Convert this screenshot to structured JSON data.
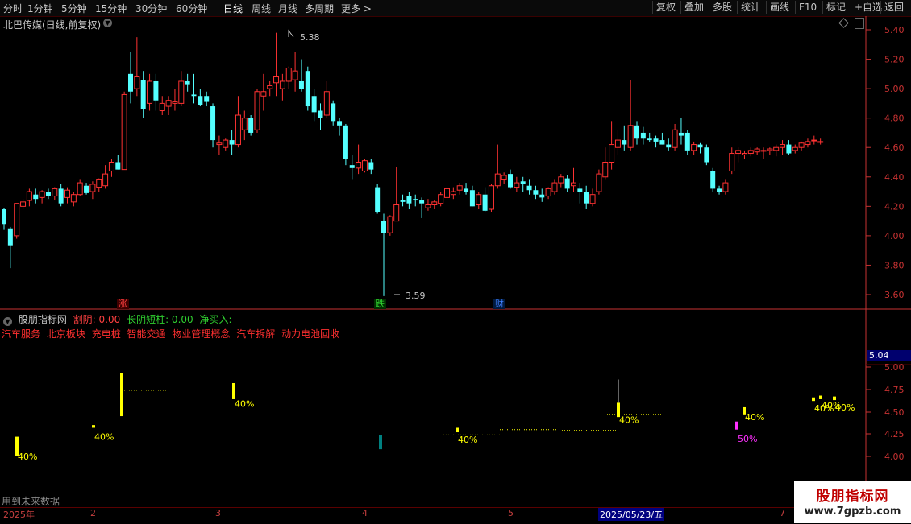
{
  "toolbar": {
    "timeframes": [
      "分时",
      "1分钟",
      "5分钟",
      "15分钟",
      "30分钟",
      "60分钟",
      "日线",
      "周线",
      "月线",
      "多周期",
      "更多 >"
    ],
    "active": "日线",
    "buttons": [
      "复权",
      "叠加",
      "多股",
      "统计",
      "画线",
      "F10",
      "标记",
      "+自选",
      "返回"
    ]
  },
  "chart_title": "北巴传媒(日线,前复权)",
  "annotations": {
    "high_label": "5.38",
    "low_label": "3.59"
  },
  "event_tags": [
    {
      "label": "涨",
      "color": "#ff4040"
    },
    {
      "label": "跌",
      "color": "#30d030"
    },
    {
      "label": "财",
      "color": "#4080ff"
    }
  ],
  "indicator": {
    "name": "股朋指标网",
    "fields": [
      {
        "label": "割阴: 0.00",
        "color": "#ff4040"
      },
      {
        "label": "长阴短柱: 0.00",
        "color": "#30d030"
      },
      {
        "label": "净买入: -",
        "color": "#30d030"
      }
    ],
    "sectors": [
      "汽车服务",
      "北京板块",
      "充电桩",
      "智能交通",
      "物业管理概念",
      "汽车拆解",
      "动力电池回收"
    ],
    "current_price": "5.04",
    "percent_labels": [
      "40%",
      "40%",
      "40%",
      "40%",
      "40%",
      "50%",
      "40%",
      "40%",
      "40%",
      "40%"
    ]
  },
  "future_data": "用到未来数据",
  "watermark": {
    "title": "股朋指标网",
    "url": "www.7gpzb.com"
  },
  "dates": [
    "2025年",
    "2",
    "3",
    "4",
    "5",
    "2025/05/23/五",
    "7"
  ],
  "colors": {
    "up": "#ff3232",
    "down": "#54ffff",
    "yellow": "#ffff00",
    "magenta": "#ff30ff",
    "teal": "#008080",
    "axis": "#c83232"
  },
  "chart_data": {
    "type": "candlestick",
    "y_ticks": [
      "5.40",
      "5.20",
      "5.00",
      "4.80",
      "4.60",
      "4.40",
      "4.20",
      "4.00",
      "3.80",
      "3.60"
    ],
    "ylim": [
      3.56,
      5.45
    ],
    "ohlc": [
      [
        4.18,
        4.19,
        4.04,
        4.08
      ],
      [
        4.05,
        4.06,
        3.78,
        3.93
      ],
      [
        4.0,
        4.22,
        3.98,
        4.22
      ],
      [
        4.2,
        4.25,
        4.18,
        4.23
      ],
      [
        4.24,
        4.32,
        4.2,
        4.3
      ],
      [
        4.28,
        4.32,
        4.22,
        4.25
      ],
      [
        4.26,
        4.31,
        4.22,
        4.3
      ],
      [
        4.3,
        4.32,
        4.25,
        4.27
      ],
      [
        4.27,
        4.33,
        4.24,
        4.32
      ],
      [
        4.32,
        4.35,
        4.2,
        4.22
      ],
      [
        4.26,
        4.33,
        4.22,
        4.31
      ],
      [
        4.23,
        4.3,
        4.2,
        4.28
      ],
      [
        4.28,
        4.38,
        4.27,
        4.36
      ],
      [
        4.34,
        4.36,
        4.28,
        4.29
      ],
      [
        4.3,
        4.37,
        4.25,
        4.35
      ],
      [
        4.33,
        4.39,
        4.3,
        4.38
      ],
      [
        4.34,
        4.48,
        4.32,
        4.42
      ],
      [
        4.44,
        4.52,
        4.4,
        4.5
      ],
      [
        4.5,
        4.55,
        4.45,
        4.45
      ],
      [
        4.45,
        4.98,
        4.46,
        4.96
      ],
      [
        5.1,
        5.25,
        4.9,
        4.98
      ],
      [
        5.0,
        5.35,
        4.95,
        5.08
      ],
      [
        5.06,
        5.12,
        4.8,
        4.86
      ],
      [
        4.9,
        5.1,
        4.85,
        5.05
      ],
      [
        5.05,
        5.1,
        4.85,
        4.92
      ],
      [
        4.85,
        4.95,
        4.82,
        4.9
      ],
      [
        4.88,
        4.95,
        4.82,
        4.92
      ],
      [
        4.9,
        5.0,
        4.85,
        4.91
      ],
      [
        4.9,
        5.12,
        4.88,
        5.05
      ],
      [
        5.05,
        5.1,
        4.98,
        5.03
      ],
      [
        4.96,
        5.1,
        4.9,
        4.95
      ],
      [
        4.95,
        5.0,
        4.88,
        4.89
      ],
      [
        4.95,
        4.98,
        4.88,
        4.91
      ],
      [
        4.88,
        4.9,
        4.6,
        4.65
      ],
      [
        4.62,
        4.68,
        4.55,
        4.63
      ],
      [
        4.6,
        4.66,
        4.58,
        4.65
      ],
      [
        4.65,
        4.72,
        4.55,
        4.62
      ],
      [
        4.62,
        4.95,
        4.6,
        4.82
      ],
      [
        4.72,
        4.85,
        4.65,
        4.8
      ],
      [
        4.8,
        4.82,
        4.68,
        4.7
      ],
      [
        4.72,
        5.0,
        4.7,
        4.98
      ],
      [
        4.95,
        5.1,
        4.85,
        4.98
      ],
      [
        5.0,
        5.05,
        4.95,
        5.02
      ],
      [
        5.04,
        5.38,
        4.95,
        5.08
      ],
      [
        5.0,
        5.1,
        4.92,
        5.05
      ],
      [
        5.05,
        5.15,
        5.0,
        5.14
      ],
      [
        5.06,
        5.25,
        4.98,
        5.12
      ],
      [
        5.05,
        5.2,
        4.98,
        5.0
      ],
      [
        5.12,
        5.15,
        4.85,
        4.88
      ],
      [
        4.95,
        5.0,
        4.78,
        4.84
      ],
      [
        4.85,
        4.9,
        4.72,
        4.8
      ],
      [
        4.82,
        5.05,
        4.8,
        4.98
      ],
      [
        4.9,
        4.92,
        4.75,
        4.78
      ],
      [
        4.78,
        4.8,
        4.68,
        4.75
      ],
      [
        4.75,
        4.76,
        4.48,
        4.52
      ],
      [
        4.48,
        4.55,
        4.38,
        4.46
      ],
      [
        4.46,
        4.62,
        4.42,
        4.5
      ],
      [
        4.44,
        4.52,
        4.43,
        4.51
      ],
      [
        4.5,
        4.52,
        4.42,
        4.45
      ],
      [
        4.33,
        4.35,
        4.15,
        4.16
      ],
      [
        4.1,
        4.15,
        3.59,
        4.02
      ],
      [
        4.02,
        4.14,
        4.0,
        4.13
      ],
      [
        4.1,
        4.47,
        4.1,
        4.21
      ],
      [
        4.24,
        4.28,
        4.2,
        4.23
      ],
      [
        4.27,
        4.3,
        4.18,
        4.22
      ],
      [
        4.25,
        4.28,
        4.2,
        4.24
      ],
      [
        4.24,
        4.26,
        4.12,
        4.22
      ],
      [
        4.19,
        4.25,
        4.17,
        4.21
      ],
      [
        4.21,
        4.24,
        4.18,
        4.23
      ],
      [
        4.22,
        4.3,
        4.2,
        4.28
      ],
      [
        4.26,
        4.34,
        4.24,
        4.32
      ],
      [
        4.28,
        4.33,
        4.25,
        4.3
      ],
      [
        4.31,
        4.36,
        4.28,
        4.34
      ],
      [
        4.32,
        4.36,
        4.28,
        4.3
      ],
      [
        4.31,
        4.34,
        4.2,
        4.2
      ],
      [
        4.21,
        4.3,
        4.18,
        4.28
      ],
      [
        4.28,
        4.33,
        4.16,
        4.17
      ],
      [
        4.18,
        4.35,
        4.16,
        4.34
      ],
      [
        4.34,
        4.62,
        4.32,
        4.42
      ],
      [
        4.38,
        4.43,
        4.35,
        4.41
      ],
      [
        4.42,
        4.45,
        4.32,
        4.33
      ],
      [
        4.33,
        4.4,
        4.3,
        4.36
      ],
      [
        4.37,
        4.4,
        4.3,
        4.35
      ],
      [
        4.34,
        4.38,
        4.28,
        4.31
      ],
      [
        4.31,
        4.34,
        4.25,
        4.28
      ],
      [
        4.28,
        4.32,
        4.23,
        4.26
      ],
      [
        4.27,
        4.33,
        4.25,
        4.32
      ],
      [
        4.3,
        4.38,
        4.28,
        4.36
      ],
      [
        4.36,
        4.42,
        4.33,
        4.4
      ],
      [
        4.39,
        4.41,
        4.3,
        4.32
      ],
      [
        4.34,
        4.46,
        4.3,
        4.36
      ],
      [
        4.32,
        4.36,
        4.22,
        4.3
      ],
      [
        4.3,
        4.34,
        4.18,
        4.22
      ],
      [
        4.22,
        4.32,
        4.2,
        4.28
      ],
      [
        4.3,
        4.45,
        4.28,
        4.42
      ],
      [
        4.4,
        4.6,
        4.38,
        4.5
      ],
      [
        4.5,
        4.78,
        4.45,
        4.62
      ],
      [
        4.6,
        4.72,
        4.55,
        4.65
      ],
      [
        4.65,
        4.75,
        4.58,
        4.62
      ],
      [
        4.6,
        5.06,
        4.58,
        4.75
      ],
      [
        4.75,
        4.78,
        4.62,
        4.66
      ],
      [
        4.7,
        4.74,
        4.62,
        4.66
      ],
      [
        4.66,
        4.7,
        4.64,
        4.65
      ],
      [
        4.66,
        4.68,
        4.6,
        4.64
      ],
      [
        4.65,
        4.7,
        4.62,
        4.62
      ],
      [
        4.62,
        4.66,
        4.58,
        4.6
      ],
      [
        4.6,
        4.76,
        4.58,
        4.72
      ],
      [
        4.7,
        4.8,
        4.62,
        4.68
      ],
      [
        4.7,
        4.72,
        4.55,
        4.58
      ],
      [
        4.58,
        4.64,
        4.55,
        4.62
      ],
      [
        4.62,
        4.63,
        4.56,
        4.6
      ],
      [
        4.6,
        4.62,
        4.48,
        4.5
      ],
      [
        4.44,
        4.46,
        4.3,
        4.32
      ],
      [
        4.32,
        4.34,
        4.28,
        4.3
      ],
      [
        4.3,
        4.38,
        4.28,
        4.36
      ],
      [
        4.44,
        4.6,
        4.42,
        4.56
      ],
      [
        4.56,
        4.6,
        4.5,
        4.58
      ],
      [
        4.55,
        4.58,
        4.52,
        4.56
      ],
      [
        4.56,
        4.6,
        4.54,
        4.58
      ],
      [
        4.57,
        4.6,
        4.55,
        4.59
      ],
      [
        4.58,
        4.6,
        4.52,
        4.58
      ],
      [
        4.58,
        4.6,
        4.55,
        4.59
      ],
      [
        4.58,
        4.62,
        4.54,
        4.6
      ],
      [
        4.6,
        4.65,
        4.55,
        4.62
      ],
      [
        4.62,
        4.65,
        4.55,
        4.56
      ],
      [
        4.58,
        4.62,
        4.56,
        4.6
      ],
      [
        4.6,
        4.64,
        4.58,
        4.63
      ],
      [
        4.62,
        4.66,
        4.6,
        4.64
      ],
      [
        4.65,
        4.68,
        4.62,
        4.65
      ],
      [
        4.64,
        4.66,
        4.62,
        4.64
      ]
    ]
  }
}
